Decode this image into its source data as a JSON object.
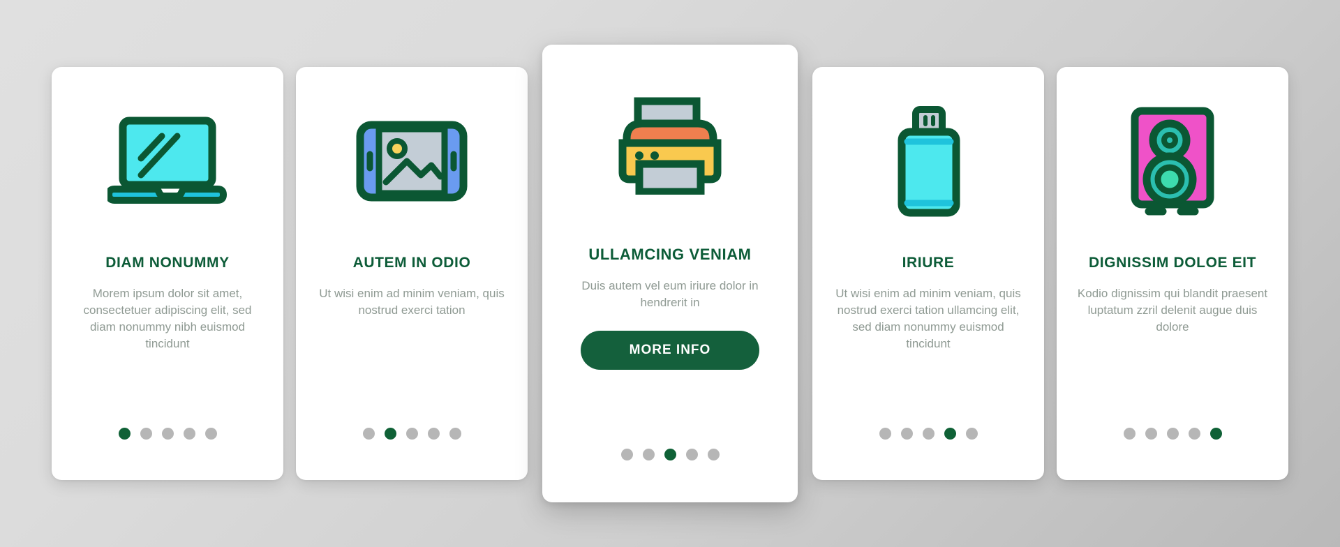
{
  "theme": {
    "accent_green": "#0d5c38",
    "button_green": "#14603c",
    "body_text_gray": "#8f9a93",
    "dot_inactive": "#b6b6b6",
    "dot_active": "#0f6136",
    "card_background": "#ffffff",
    "page_background": "#d6d6d6",
    "icon_outline": "#0b5733",
    "icon_cyan": "#4de8ee",
    "icon_blue": "#6a9bf0",
    "icon_gray": "#c3cdd6",
    "icon_yellow": "#f9c94f",
    "icon_orange": "#ef7f4f",
    "icon_magenta": "#ef52c8",
    "icon_teal": "#2bbfb0"
  },
  "pagination": {
    "total": 5
  },
  "cards": [
    {
      "index": 0,
      "icon": "laptop-icon",
      "title": "DIAM NONUMMY",
      "body": "Morem ipsum dolor sit amet, consectetuer adipiscing elit, sed diam nonummy nibh euismod tincidunt",
      "active_dot": 0,
      "has_button": false,
      "button_label": ""
    },
    {
      "index": 1,
      "icon": "tablet-photo-icon",
      "title": "AUTEM IN ODIO",
      "body": "Ut wisi enim ad minim veniam, quis nostrud exerci tation",
      "active_dot": 1,
      "has_button": false,
      "button_label": ""
    },
    {
      "index": 2,
      "icon": "printer-icon",
      "title": "ULLAMCING VENIAM",
      "body": "Duis autem vel eum iriure dolor in hendrerit in",
      "active_dot": 2,
      "has_button": true,
      "button_label": "MORE INFO"
    },
    {
      "index": 3,
      "icon": "usb-flash-drive-icon",
      "title": "IRIURE",
      "body": "Ut wisi enim ad minim veniam, quis nostrud exerci tation ullamcing elit, sed diam nonummy euismod tincidunt",
      "active_dot": 3,
      "has_button": false,
      "button_label": ""
    },
    {
      "index": 4,
      "icon": "speaker-icon",
      "title": "DIGNISSIM DOLOE EIT",
      "body": "Kodio dignissim qui blandit praesent luptatum zzril delenit augue duis dolore",
      "active_dot": 4,
      "has_button": false,
      "button_label": ""
    }
  ]
}
